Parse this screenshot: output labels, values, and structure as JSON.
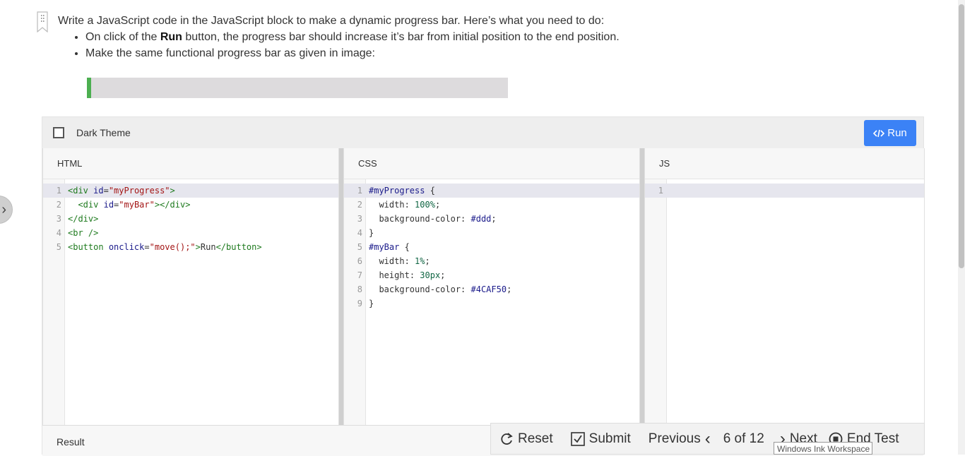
{
  "question": {
    "intro": "Write a JavaScript code in the JavaScript block to make a dynamic progress bar. Here’s what you need to do:",
    "bullet1_pre": "On click of the ",
    "bullet1_bold": "Run",
    "bullet1_post": " button, the progress bar should increase it’s bar from initial position to the end position.",
    "bullet2": "Make the same functional progress bar as given in image:"
  },
  "demo_progress": {
    "fraction": 0.01,
    "fill_color": "#4CAF50",
    "track_color": "#dddbdd"
  },
  "editor": {
    "dark_theme_label": "Dark Theme",
    "run_label": "Run",
    "run_icon": "code-icon",
    "html_label": "HTML",
    "css_label": "CSS",
    "js_label": "JS",
    "result_label": "Result",
    "html_lines": [
      "<div id=\"myProgress\">",
      "  <div id=\"myBar\"></div>",
      "</div>",
      "<br />",
      "<button onclick=\"move();\">Run</button>"
    ],
    "css_lines": [
      "#myProgress {",
      "  width: 100%;",
      "  background-color: #ddd;",
      "}",
      "#myBar {",
      "  width: 1%;",
      "  height: 30px;",
      "  background-color: #4CAF50;",
      "}"
    ],
    "js_lines": [
      ""
    ]
  },
  "nav": {
    "reset_label": "Reset",
    "submit_label": "Submit",
    "previous_label": "Previous",
    "page_indicator": "6 of 12",
    "next_label": "Next",
    "end_label": "End Test"
  },
  "tooltip": "Windows Ink Workspace"
}
